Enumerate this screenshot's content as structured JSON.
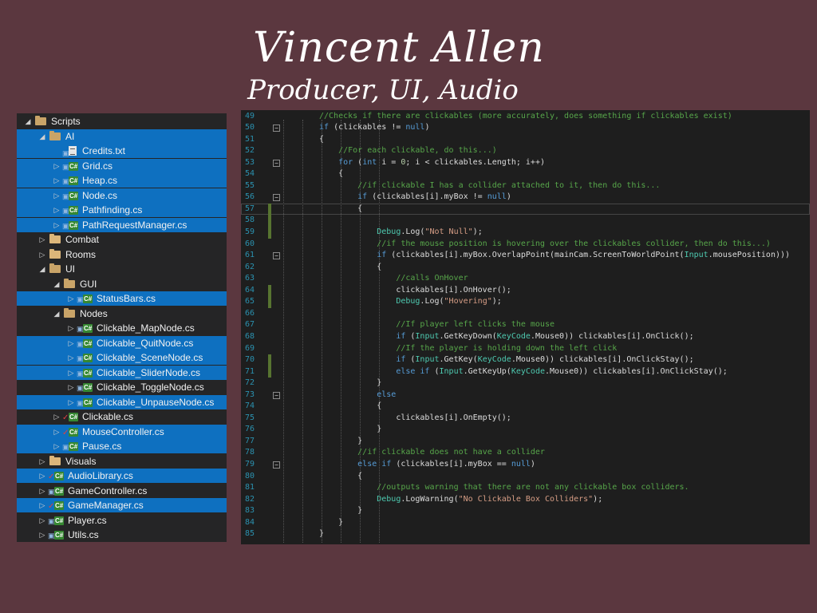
{
  "header": {
    "name": "Vincent Allen",
    "role": "Producer, UI, Audio"
  },
  "explorer": {
    "items": [
      {
        "label": "Scripts",
        "depth": 0,
        "icon": "folder-open-icon",
        "expander": "open",
        "selected": false
      },
      {
        "label": "AI",
        "depth": 1,
        "icon": "folder-open-icon",
        "expander": "open",
        "selected": true
      },
      {
        "label": "Credits.txt",
        "depth": 2,
        "icon": "text-file-icon",
        "expander": "none",
        "selected": true,
        "badge": "lock"
      },
      {
        "label": "Grid.cs",
        "depth": 2,
        "icon": "csharp-file-icon",
        "expander": "closed",
        "selected": true,
        "badge": "lock"
      },
      {
        "label": "Heap.cs",
        "depth": 2,
        "icon": "csharp-file-icon",
        "expander": "closed",
        "selected": true,
        "badge": "lock"
      },
      {
        "label": "Node.cs",
        "depth": 2,
        "icon": "csharp-file-icon",
        "expander": "closed",
        "selected": true,
        "badge": "lock"
      },
      {
        "label": "Pathfinding.cs",
        "depth": 2,
        "icon": "csharp-file-icon",
        "expander": "closed",
        "selected": true,
        "badge": "lock"
      },
      {
        "label": "PathRequestManager.cs",
        "depth": 2,
        "icon": "csharp-file-icon",
        "expander": "closed",
        "selected": true,
        "badge": "lock"
      },
      {
        "label": "Combat",
        "depth": 1,
        "icon": "folder-icon",
        "expander": "closed",
        "selected": false
      },
      {
        "label": "Rooms",
        "depth": 1,
        "icon": "folder-icon",
        "expander": "closed",
        "selected": false
      },
      {
        "label": "UI",
        "depth": 1,
        "icon": "folder-open-icon",
        "expander": "open",
        "selected": false
      },
      {
        "label": "GUI",
        "depth": 2,
        "icon": "folder-open-icon",
        "expander": "open",
        "selected": false
      },
      {
        "label": "StatusBars.cs",
        "depth": 3,
        "icon": "csharp-file-icon",
        "expander": "closed",
        "selected": true,
        "badge": "lock"
      },
      {
        "label": "Nodes",
        "depth": 2,
        "icon": "folder-open-icon",
        "expander": "open",
        "selected": false
      },
      {
        "label": "Clickable_MapNode.cs",
        "depth": 3,
        "icon": "csharp-file-icon",
        "expander": "closed",
        "selected": false,
        "badge": "lock"
      },
      {
        "label": "Clickable_QuitNode.cs",
        "depth": 3,
        "icon": "csharp-file-icon",
        "expander": "closed",
        "selected": true,
        "badge": "lock"
      },
      {
        "label": "Clickable_SceneNode.cs",
        "depth": 3,
        "icon": "csharp-file-icon",
        "expander": "closed",
        "selected": true,
        "badge": "lock"
      },
      {
        "label": "Clickable_SliderNode.cs",
        "depth": 3,
        "icon": "csharp-file-icon",
        "expander": "closed",
        "selected": true,
        "badge": "lock"
      },
      {
        "label": "Clickable_ToggleNode.cs",
        "depth": 3,
        "icon": "csharp-file-icon",
        "expander": "closed",
        "selected": false,
        "badge": "lock"
      },
      {
        "label": "Clickable_UnpauseNode.cs",
        "depth": 3,
        "icon": "csharp-file-icon",
        "expander": "closed",
        "selected": true,
        "badge": "lock"
      },
      {
        "label": "Clickable.cs",
        "depth": 2,
        "icon": "csharp-file-icon",
        "expander": "closed",
        "selected": false,
        "badge": "check"
      },
      {
        "label": "MouseController.cs",
        "depth": 2,
        "icon": "csharp-file-icon",
        "expander": "closed",
        "selected": true,
        "badge": "check"
      },
      {
        "label": "Pause.cs",
        "depth": 2,
        "icon": "csharp-file-icon",
        "expander": "closed",
        "selected": true,
        "badge": "lock"
      },
      {
        "label": "Visuals",
        "depth": 1,
        "icon": "folder-icon",
        "expander": "closed",
        "selected": false
      },
      {
        "label": "AudioLibrary.cs",
        "depth": 1,
        "icon": "csharp-file-icon",
        "expander": "closed",
        "selected": true,
        "badge": "check"
      },
      {
        "label": "GameController.cs",
        "depth": 1,
        "icon": "csharp-file-icon",
        "expander": "closed",
        "selected": false,
        "badge": "lock"
      },
      {
        "label": "GameManager.cs",
        "depth": 1,
        "icon": "csharp-file-icon",
        "expander": "closed",
        "selected": true,
        "badge": "check"
      },
      {
        "label": "Player.cs",
        "depth": 1,
        "icon": "csharp-file-icon",
        "expander": "closed",
        "selected": false,
        "badge": "lock"
      },
      {
        "label": "Utils.cs",
        "depth": 1,
        "icon": "csharp-file-icon",
        "expander": "closed",
        "selected": false,
        "badge": "lock"
      }
    ]
  },
  "editor": {
    "lines": [
      {
        "n": "49",
        "indent": 2,
        "fold": "",
        "changed": false,
        "tokens": [
          [
            "com",
            "//Checks if there are clickables (more accurately, does something if clickables exist)"
          ]
        ]
      },
      {
        "n": "50",
        "indent": 2,
        "fold": "minus",
        "changed": false,
        "tokens": [
          [
            "kw",
            "if"
          ],
          [
            "pl",
            " (clickables != "
          ],
          [
            "kw",
            "null"
          ],
          [
            "pl",
            ")"
          ]
        ]
      },
      {
        "n": "51",
        "indent": 2,
        "fold": "",
        "changed": false,
        "tokens": [
          [
            "pl",
            "{"
          ]
        ]
      },
      {
        "n": "52",
        "indent": 3,
        "fold": "",
        "changed": false,
        "tokens": [
          [
            "com",
            "//For each clickable, do this...)"
          ]
        ]
      },
      {
        "n": "53",
        "indent": 3,
        "fold": "minus",
        "changed": false,
        "tokens": [
          [
            "kw",
            "for"
          ],
          [
            "pl",
            " ("
          ],
          [
            "kw",
            "int"
          ],
          [
            "pl",
            " i = "
          ],
          [
            "num",
            "0"
          ],
          [
            "pl",
            "; i < clickables.Length; i++)"
          ]
        ]
      },
      {
        "n": "54",
        "indent": 3,
        "fold": "",
        "changed": false,
        "tokens": [
          [
            "pl",
            "{"
          ]
        ]
      },
      {
        "n": "55",
        "indent": 4,
        "fold": "",
        "changed": false,
        "tokens": [
          [
            "com",
            "//if clickable I has a collider attached to it, then do this..."
          ]
        ]
      },
      {
        "n": "56",
        "indent": 4,
        "fold": "minus",
        "changed": false,
        "tokens": [
          [
            "kw",
            "if"
          ],
          [
            "pl",
            " (clickables[i].myBox != "
          ],
          [
            "kw",
            "null"
          ],
          [
            "pl",
            ")"
          ]
        ]
      },
      {
        "n": "57",
        "indent": 4,
        "fold": "",
        "changed": true,
        "current": true,
        "tokens": [
          [
            "pl",
            "{"
          ]
        ]
      },
      {
        "n": "58",
        "indent": 5,
        "fold": "",
        "changed": true,
        "tokens": []
      },
      {
        "n": "59",
        "indent": 5,
        "fold": "",
        "changed": true,
        "tokens": [
          [
            "typ",
            "Debug"
          ],
          [
            "pl",
            ".Log("
          ],
          [
            "str",
            "\"Not Null\""
          ],
          [
            "pl",
            ");"
          ]
        ]
      },
      {
        "n": "60",
        "indent": 5,
        "fold": "",
        "changed": false,
        "tokens": [
          [
            "com",
            "//if the mouse position is hovering over the clickables collider, then do this...)"
          ]
        ]
      },
      {
        "n": "61",
        "indent": 5,
        "fold": "minus",
        "changed": false,
        "tokens": [
          [
            "kw",
            "if"
          ],
          [
            "pl",
            " (clickables[i].myBox.OverlapPoint(mainCam.ScreenToWorldPoint("
          ],
          [
            "typ",
            "Input"
          ],
          [
            "pl",
            ".mousePosition)))"
          ]
        ]
      },
      {
        "n": "62",
        "indent": 5,
        "fold": "",
        "changed": false,
        "tokens": [
          [
            "pl",
            "{"
          ]
        ]
      },
      {
        "n": "63",
        "indent": 6,
        "fold": "",
        "changed": false,
        "tokens": [
          [
            "com",
            "//calls OnHover"
          ]
        ]
      },
      {
        "n": "64",
        "indent": 6,
        "fold": "",
        "changed": true,
        "tokens": [
          [
            "pl",
            "clickables[i].OnHover();"
          ]
        ]
      },
      {
        "n": "65",
        "indent": 6,
        "fold": "",
        "changed": true,
        "tokens": [
          [
            "typ",
            "Debug"
          ],
          [
            "pl",
            ".Log("
          ],
          [
            "str",
            "\"Hovering\""
          ],
          [
            "pl",
            ");"
          ]
        ]
      },
      {
        "n": "66",
        "indent": 6,
        "fold": "",
        "changed": false,
        "tokens": []
      },
      {
        "n": "67",
        "indent": 6,
        "fold": "",
        "changed": false,
        "tokens": [
          [
            "com",
            "//If player left clicks the mouse"
          ]
        ]
      },
      {
        "n": "68",
        "indent": 6,
        "fold": "",
        "changed": false,
        "tokens": [
          [
            "kw",
            "if"
          ],
          [
            "pl",
            " ("
          ],
          [
            "typ",
            "Input"
          ],
          [
            "pl",
            ".GetKeyDown("
          ],
          [
            "typ",
            "KeyCode"
          ],
          [
            "pl",
            ".Mouse0)) clickables[i].OnClick();"
          ]
        ]
      },
      {
        "n": "69",
        "indent": 6,
        "fold": "",
        "changed": false,
        "tokens": [
          [
            "com",
            "//If the player is holding down the left click"
          ]
        ]
      },
      {
        "n": "70",
        "indent": 6,
        "fold": "",
        "changed": true,
        "tokens": [
          [
            "kw",
            "if"
          ],
          [
            "pl",
            " ("
          ],
          [
            "typ",
            "Input"
          ],
          [
            "pl",
            ".GetKey("
          ],
          [
            "typ",
            "KeyCode"
          ],
          [
            "pl",
            ".Mouse0)) clickables[i].OnClickStay();"
          ]
        ]
      },
      {
        "n": "71",
        "indent": 6,
        "fold": "",
        "changed": true,
        "tokens": [
          [
            "kw",
            "else if"
          ],
          [
            "pl",
            " ("
          ],
          [
            "typ",
            "Input"
          ],
          [
            "pl",
            ".GetKeyUp("
          ],
          [
            "typ",
            "KeyCode"
          ],
          [
            "pl",
            ".Mouse0)) clickables[i].OnClickStay();"
          ]
        ]
      },
      {
        "n": "72",
        "indent": 5,
        "fold": "",
        "changed": false,
        "tokens": [
          [
            "pl",
            "}"
          ]
        ]
      },
      {
        "n": "73",
        "indent": 5,
        "fold": "minus",
        "changed": false,
        "tokens": [
          [
            "kw",
            "else"
          ]
        ]
      },
      {
        "n": "74",
        "indent": 5,
        "fold": "",
        "changed": false,
        "tokens": [
          [
            "pl",
            "{"
          ]
        ]
      },
      {
        "n": "75",
        "indent": 6,
        "fold": "",
        "changed": false,
        "tokens": [
          [
            "pl",
            "clickables[i].OnEmpty();"
          ]
        ]
      },
      {
        "n": "76",
        "indent": 5,
        "fold": "",
        "changed": false,
        "tokens": [
          [
            "pl",
            "}"
          ]
        ]
      },
      {
        "n": "77",
        "indent": 4,
        "fold": "",
        "changed": false,
        "tokens": [
          [
            "pl",
            "}"
          ]
        ]
      },
      {
        "n": "78",
        "indent": 4,
        "fold": "",
        "changed": false,
        "tokens": [
          [
            "com",
            "//if clickable does not have a collider"
          ]
        ]
      },
      {
        "n": "79",
        "indent": 4,
        "fold": "minus",
        "changed": false,
        "tokens": [
          [
            "kw",
            "else if"
          ],
          [
            "pl",
            " (clickables[i].myBox == "
          ],
          [
            "kw",
            "null"
          ],
          [
            "pl",
            ")"
          ]
        ]
      },
      {
        "n": "80",
        "indent": 4,
        "fold": "",
        "changed": false,
        "tokens": [
          [
            "pl",
            "{"
          ]
        ]
      },
      {
        "n": "81",
        "indent": 5,
        "fold": "",
        "changed": false,
        "tokens": [
          [
            "com",
            "//outputs warning that there are not any clickable box colliders."
          ]
        ]
      },
      {
        "n": "82",
        "indent": 5,
        "fold": "",
        "changed": false,
        "tokens": [
          [
            "typ",
            "Debug"
          ],
          [
            "pl",
            ".LogWarning("
          ],
          [
            "str",
            "\"No Clickable Box Colliders\""
          ],
          [
            "pl",
            ");"
          ]
        ]
      },
      {
        "n": "83",
        "indent": 4,
        "fold": "",
        "changed": false,
        "tokens": [
          [
            "pl",
            "}"
          ]
        ]
      },
      {
        "n": "84",
        "indent": 3,
        "fold": "",
        "changed": false,
        "tokens": [
          [
            "pl",
            "}"
          ]
        ]
      },
      {
        "n": "85",
        "indent": 2,
        "fold": "",
        "changed": false,
        "tokens": [
          [
            "pl",
            "}"
          ]
        ]
      }
    ]
  },
  "colors": {
    "background": "#5b373f",
    "explorer_bg": "#252526",
    "selection": "#0e70c0",
    "editor_bg": "#1e1e1e",
    "comment": "#57a64a",
    "keyword": "#569cd6",
    "string": "#d69d85",
    "type": "#4ec9b0",
    "line_number": "#2b91af"
  }
}
